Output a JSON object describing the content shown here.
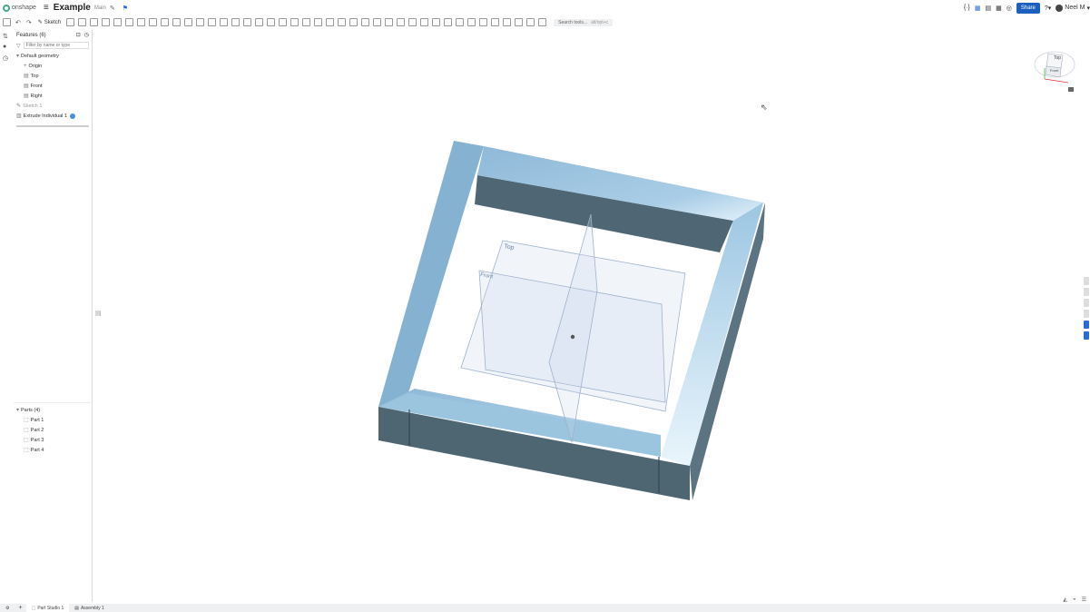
{
  "app": {
    "logo_text": "onshape",
    "doc_title": "Example",
    "branch": "Main"
  },
  "top_right": {
    "share_label": "Share",
    "user_label": "Neel M"
  },
  "toolbar": {
    "sketch_label": "Sketch",
    "search_placeholder": "Search tools...",
    "search_shortcut": "alt/opt+c"
  },
  "features": {
    "header": "Features (6)",
    "filter_placeholder": "Filter by name or type",
    "default_geometry": "Default geometry",
    "items": [
      {
        "label": "Origin",
        "icon": "origin-icon"
      },
      {
        "label": "Top",
        "icon": "plane-icon"
      },
      {
        "label": "Front",
        "icon": "plane-icon"
      },
      {
        "label": "Right",
        "icon": "plane-icon"
      }
    ],
    "sketch": "Sketch 1",
    "extrude": "Extrude Individual 1"
  },
  "parts": {
    "header": "Parts (4)",
    "items": [
      "Part 1",
      "Part 2",
      "Part 3",
      "Part 4"
    ]
  },
  "viewport": {
    "plane_top_label": "Top",
    "plane_front_label": "Front",
    "viewcube_top": "Top",
    "viewcube_front": "Front"
  },
  "tabs": [
    {
      "label": "Part Studio 1",
      "active": true
    },
    {
      "label": "Assembly 1",
      "active": false
    }
  ],
  "colors": {
    "accent": "#1b5fbf",
    "part_top": "#8ab6d6",
    "part_side": "#546b78"
  }
}
